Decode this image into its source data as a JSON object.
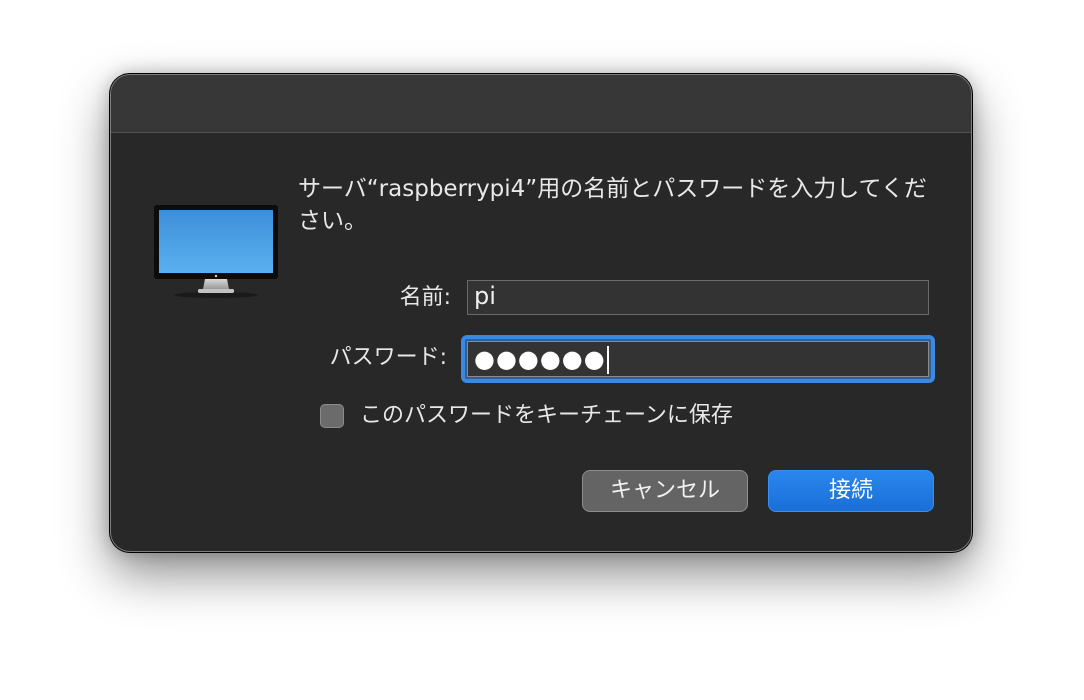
{
  "dialog": {
    "message": "サーバ“raspberrypi4”用の名前とパスワードを入力してください。",
    "name_label": "名前:",
    "name_value": "pi",
    "password_label": "パスワード:",
    "password_value": "●●●●●●",
    "save_keychain_label": "このパスワードをキーチェーンに保存",
    "save_keychain_checked": false,
    "cancel_label": "キャンセル",
    "connect_label": "接続"
  },
  "icons": {
    "server": "monitor-icon"
  },
  "colors": {
    "dialog_bg": "#282828",
    "titlebar_bg": "#373737",
    "accent": "#3c8ae0",
    "primary_button": "#1a6fd7"
  }
}
